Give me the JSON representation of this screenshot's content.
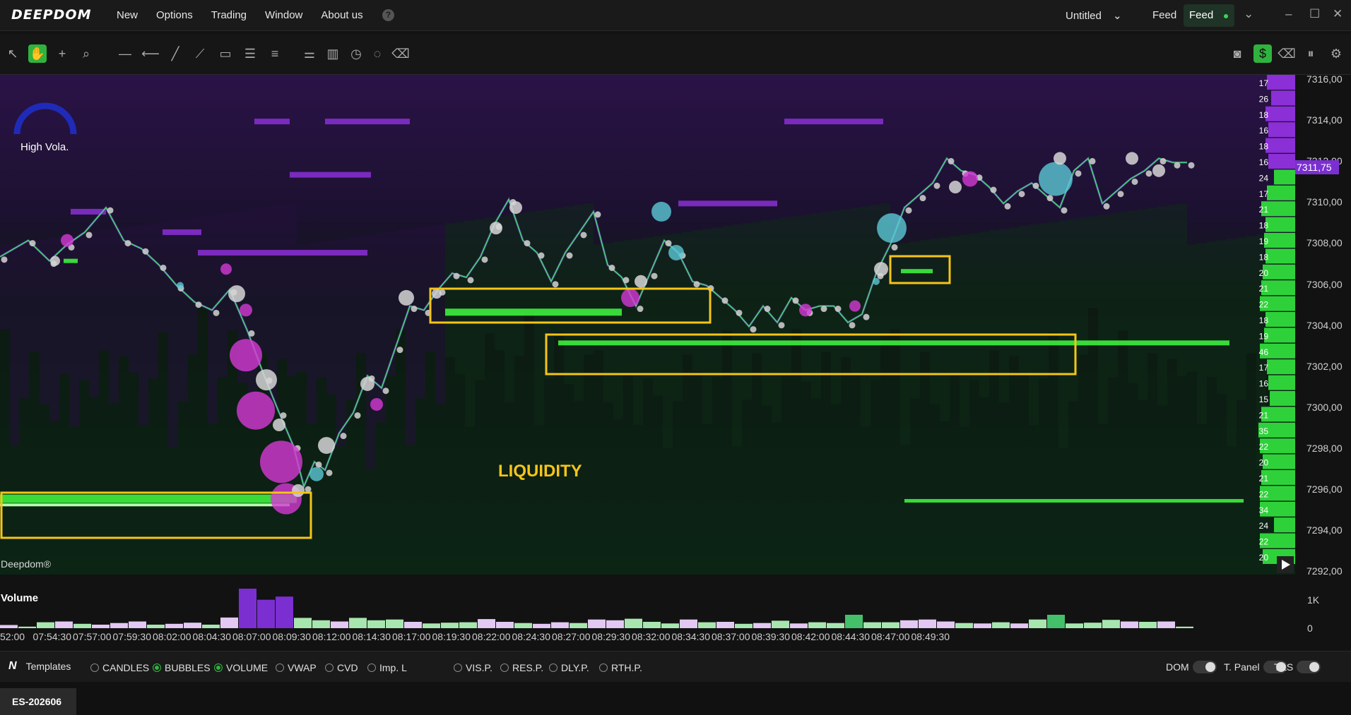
{
  "app": {
    "logo": "DEEPDOM"
  },
  "menu": [
    "New",
    "Options",
    "Trading",
    "Window",
    "About us"
  ],
  "window": {
    "workspace": "Untitled",
    "feed_label": "Feed",
    "feed_status": "Feed"
  },
  "toolbar": {
    "left_icons": [
      "pointer-icon",
      "hand-icon",
      "crosshair-icon",
      "zoom-icon",
      "horizontal-line-icon",
      "ray-icon",
      "trend-line-icon",
      "measure-icon",
      "rectangle-icon",
      "channel-icon",
      "fib-icon",
      "settings-sliders-icon",
      "bar-chart-icon",
      "timer-icon",
      "comment-icon",
      "eraser-icon"
    ],
    "right_icons": [
      "camera-icon",
      "dollar-icon",
      "eraser-icon",
      "pause-icon",
      "gear-icon"
    ]
  },
  "chart_data": {
    "type": "heatmap",
    "instrument": "ES-202606",
    "price_axis": [
      "7316,00",
      "7314,00",
      "7312,00",
      "7310,00",
      "7308,00",
      "7306,00",
      "7304,00",
      "7302,00",
      "7300,00",
      "7298,00",
      "7296,00",
      "7294,00",
      "7292,00"
    ],
    "last_price": "7311,75",
    "dom_sizes": [
      "17",
      "26",
      "18",
      "16",
      "18",
      "16",
      "24",
      "17",
      "21",
      "18",
      "19",
      "18",
      "20",
      "21",
      "22",
      "18",
      "19",
      "46",
      "17",
      "16",
      "15",
      "21",
      "35",
      "22",
      "20",
      "21",
      "22",
      "34",
      "24",
      "22",
      "20"
    ],
    "time_axis": [
      "52:00",
      "07:54:30",
      "07:57:00",
      "07:59:30",
      "08:02:00",
      "08:04:30",
      "08:07:00",
      "08:09:30",
      "08:12:00",
      "08:14:30",
      "08:17:00",
      "08:19:30",
      "08:22:00",
      "08:24:30",
      "08:27:00",
      "08:29:30",
      "08:32:00",
      "08:34:30",
      "08:37:00",
      "08:39:30",
      "08:42:00",
      "08:44:30",
      "08:47:00",
      "08:49:30"
    ],
    "volatility_label": "High Vola.",
    "annotation": "LIQUIDITY",
    "watermark": "Deepdom®",
    "colors": {
      "bid": "#3df03d",
      "ask": "#8a2be2",
      "box": "#f5c518",
      "buy_bubble": "#5bc8d6",
      "sell_bubble": "#d63ad6"
    }
  },
  "volume": {
    "label": "Volume",
    "ticks": [
      "1K",
      "0"
    ],
    "values": [
      80,
      40,
      150,
      170,
      110,
      90,
      130,
      170,
      90,
      110,
      140,
      90,
      270,
      1000,
      720,
      800,
      260,
      200,
      170,
      260,
      200,
      220,
      160,
      120,
      140,
      150,
      230,
      160,
      130,
      110,
      150,
      130,
      220,
      200,
      240,
      160,
      120,
      220,
      150,
      160,
      110,
      130,
      190,
      120,
      150,
      130,
      340,
      150,
      150,
      200,
      220,
      170,
      130,
      120,
      150,
      120,
      220,
      340,
      120,
      140,
      210,
      170,
      160,
      170,
      40
    ],
    "sides": [
      "s",
      "b",
      "b",
      "s",
      "b",
      "s",
      "s",
      "s",
      "b",
      "s",
      "s",
      "b",
      "s",
      "s",
      "s",
      "s",
      "b",
      "b",
      "s",
      "b",
      "b",
      "b",
      "s",
      "b",
      "b",
      "b",
      "s",
      "s",
      "b",
      "s",
      "s",
      "b",
      "s",
      "s",
      "b",
      "b",
      "b",
      "s",
      "b",
      "s",
      "b",
      "s",
      "b",
      "s",
      "b",
      "b",
      "b",
      "b",
      "b",
      "s",
      "s",
      "s",
      "b",
      "s",
      "b",
      "s",
      "b",
      "b",
      "b",
      "b",
      "b",
      "s",
      "b",
      "s",
      "b"
    ]
  },
  "bottombar": {
    "templates_label": "Templates",
    "options": [
      {
        "label": "CANDLES",
        "on": false
      },
      {
        "label": "BUBBLES",
        "on": true
      },
      {
        "label": "VOLUME",
        "on": true
      },
      {
        "label": "VWAP",
        "on": false
      },
      {
        "label": "CVD",
        "on": false
      },
      {
        "label": "Imp. L",
        "on": false
      }
    ],
    "options2": [
      {
        "label": "VIS.P.",
        "on": false
      },
      {
        "label": "RES.P.",
        "on": false
      },
      {
        "label": "DLY.P.",
        "on": false
      },
      {
        "label": "RTH.P.",
        "on": false
      }
    ],
    "toggles": [
      "DOM",
      "T. Panel",
      "T&S"
    ]
  },
  "tabs": {
    "symbol": "ES-202606"
  }
}
